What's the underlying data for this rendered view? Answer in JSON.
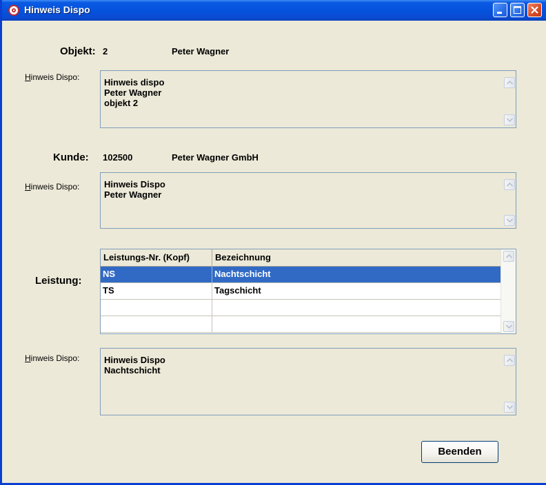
{
  "window": {
    "title": "Hinweis Dispo",
    "buttons": [
      "minimize",
      "maximize",
      "close"
    ]
  },
  "objekt": {
    "label": "Objekt:",
    "number": "2",
    "name": "Peter Wagner",
    "hint_label_mnemonic": "H",
    "hint_label_rest": "inweis Dispo:",
    "hint_text": "Hinweis dispo\nPeter Wagner\nobjekt 2"
  },
  "kunde": {
    "label": "Kunde:",
    "number": "102500",
    "name": "Peter Wagner GmbH",
    "hint_label_mnemonic": "H",
    "hint_label_rest": "inweis Dispo:",
    "hint_text": "Hinweis Dispo\nPeter Wagner"
  },
  "leistung": {
    "label": "Leistung:",
    "columns": [
      "Leistungs-Nr. (Kopf)",
      "Bezeichnung"
    ],
    "rows": [
      {
        "nr": "NS",
        "bezeichnung": "Nachtschicht",
        "selected": true
      },
      {
        "nr": "TS",
        "bezeichnung": "Tagschicht",
        "selected": false
      },
      {
        "nr": "",
        "bezeichnung": "",
        "selected": false
      },
      {
        "nr": "",
        "bezeichnung": "",
        "selected": false
      }
    ],
    "hint_label_mnemonic": "H",
    "hint_label_rest": "inweis Dispo:",
    "hint_text": "Hinweis Dispo\nNachtschicht"
  },
  "footer": {
    "close_button_label": "Beenden"
  },
  "colors": {
    "titlebar": "#0552dc",
    "selection": "#316ac5",
    "window_bg": "#ece9d8"
  },
  "icons": {
    "app": "red-eye-app-icon",
    "scroll_up": "chevron-up-icon",
    "scroll_down": "chevron-down-icon"
  }
}
